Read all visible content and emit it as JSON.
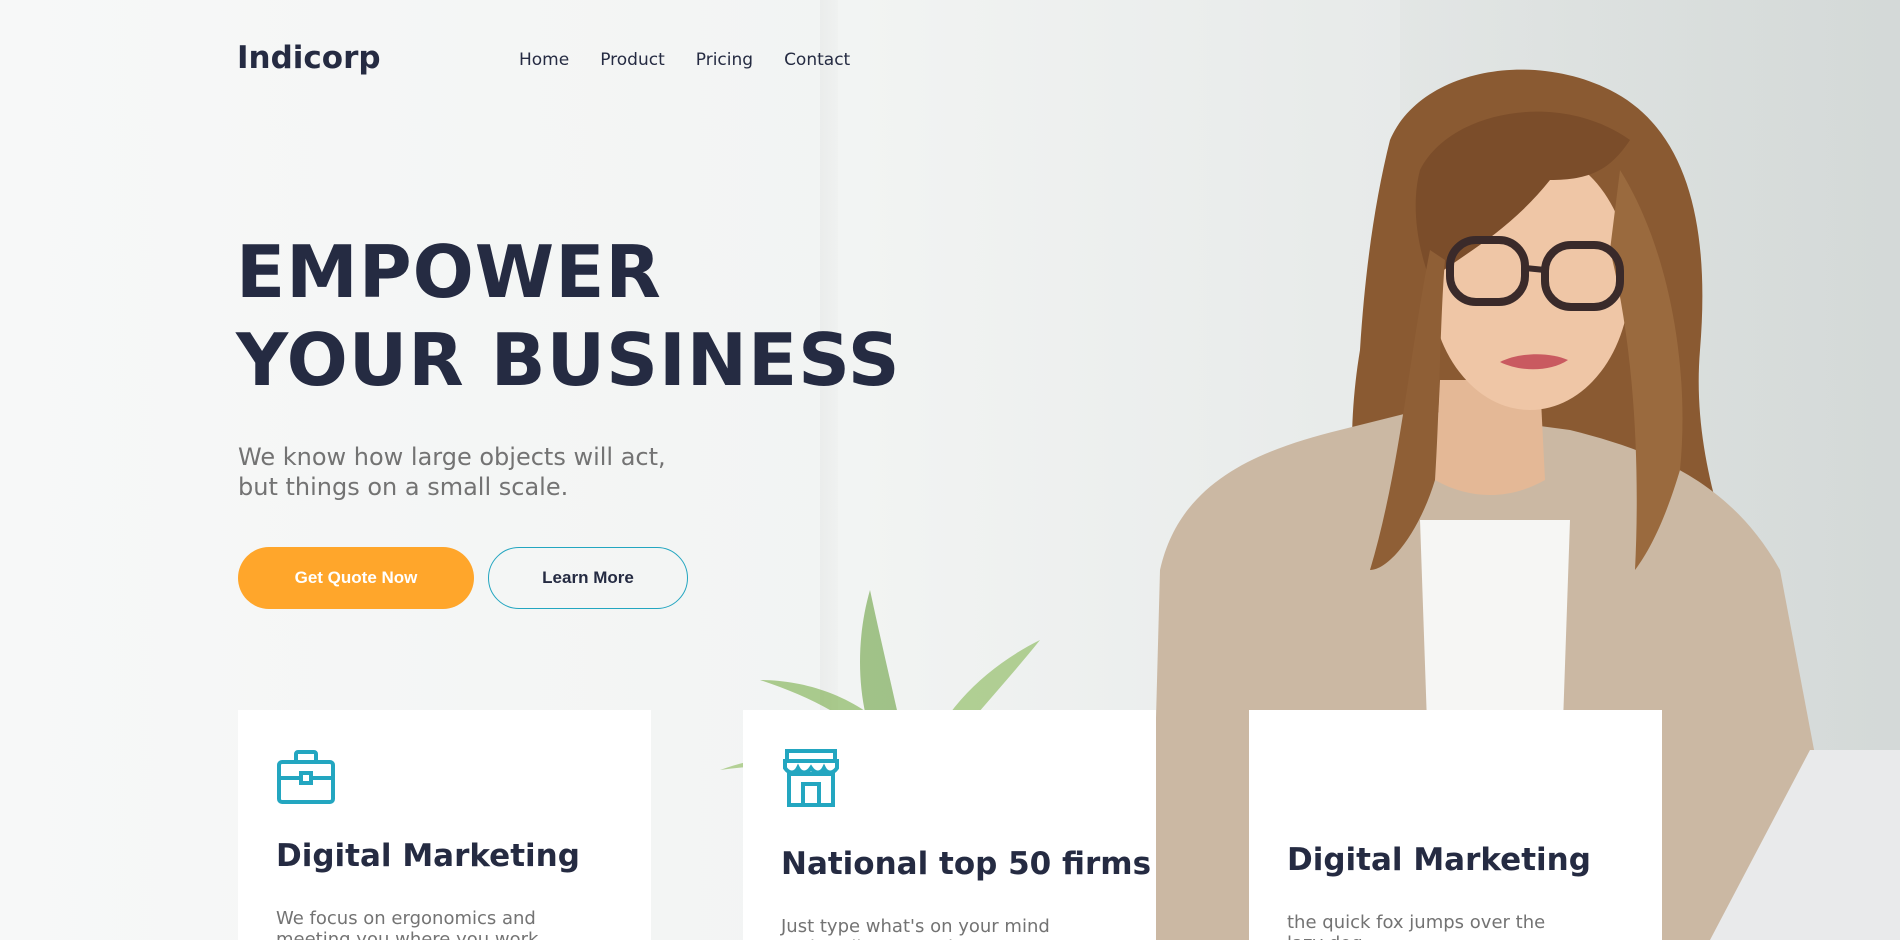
{
  "header": {
    "logo": "Indicorp",
    "nav": [
      {
        "label": "Home"
      },
      {
        "label": "Product"
      },
      {
        "label": "Pricing"
      },
      {
        "label": "Contact"
      }
    ]
  },
  "hero": {
    "title_line1": "EMPOWER",
    "title_line2": "YOUR BUSINESS",
    "subtitle_line1": "We know how large objects will act,",
    "subtitle_line2": "but things on a small scale.",
    "primary_button": "Get Quote Now",
    "secondary_button": "Learn More"
  },
  "cards": [
    {
      "icon": "briefcase-icon",
      "title": "Digital Marketing",
      "text": "We focus on ergonomics and meeting you where you work."
    },
    {
      "icon": "storefront-icon",
      "title": "National top 50 firms",
      "text": "Just type what's on your mind and we'll get you there."
    },
    {
      "icon": "",
      "title": "Digital Marketing",
      "text": "the quick fox jumps over the lazy dog"
    }
  ],
  "colors": {
    "primary_text": "#252b42",
    "muted_text": "#737373",
    "accent_orange": "#ffa62b",
    "accent_teal": "#23a6c0"
  }
}
